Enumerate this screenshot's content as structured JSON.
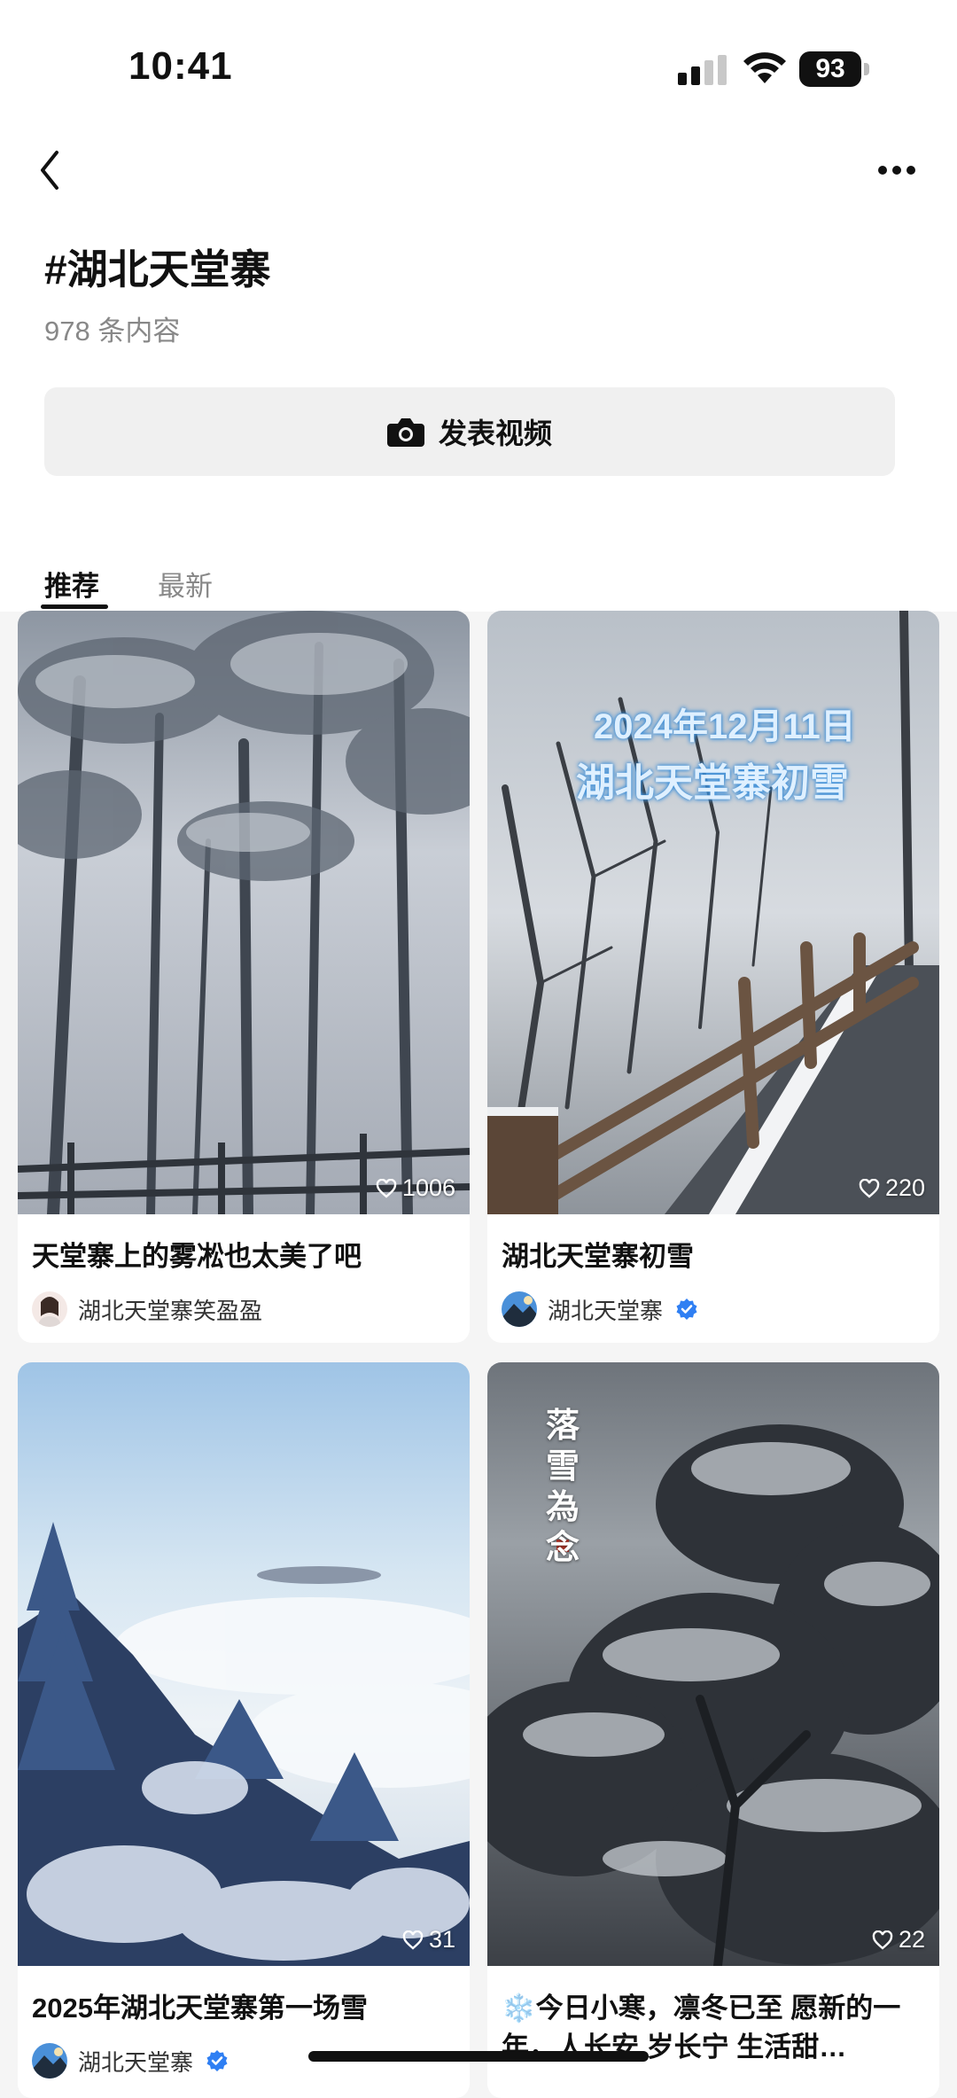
{
  "status_bar": {
    "time": "10:41",
    "battery": "93"
  },
  "header": {
    "title": "#湖北天堂寨",
    "count": "978 条内容",
    "publish_label": "发表视频"
  },
  "tabs": [
    {
      "label": "推荐",
      "active": true
    },
    {
      "label": "最新",
      "active": false
    }
  ],
  "posts": [
    {
      "title": "天堂寨上的雾凇也太美了吧",
      "author": "湖北天堂寨笑盈盈",
      "likes": "1006",
      "verified": false
    },
    {
      "title": "湖北天堂寨初雪",
      "author": "湖北天堂寨",
      "likes": "220",
      "verified": true,
      "overlay_line1": "2024年12月11日",
      "overlay_line2": "湖北天堂寨初雪"
    },
    {
      "title": "2025年湖北天堂寨第一场雪",
      "author": "湖北天堂寨",
      "likes": "31",
      "verified": true
    },
    {
      "title": "❄️今日小寒，凛冬已至 愿新的一年，人长安 岁长宁 生活甜…",
      "likes": "22",
      "overlay_vertical": "落雪為念"
    }
  ],
  "colors": {
    "accent": "#111111",
    "verified": "#2f7ff3",
    "muted": "#888888"
  }
}
